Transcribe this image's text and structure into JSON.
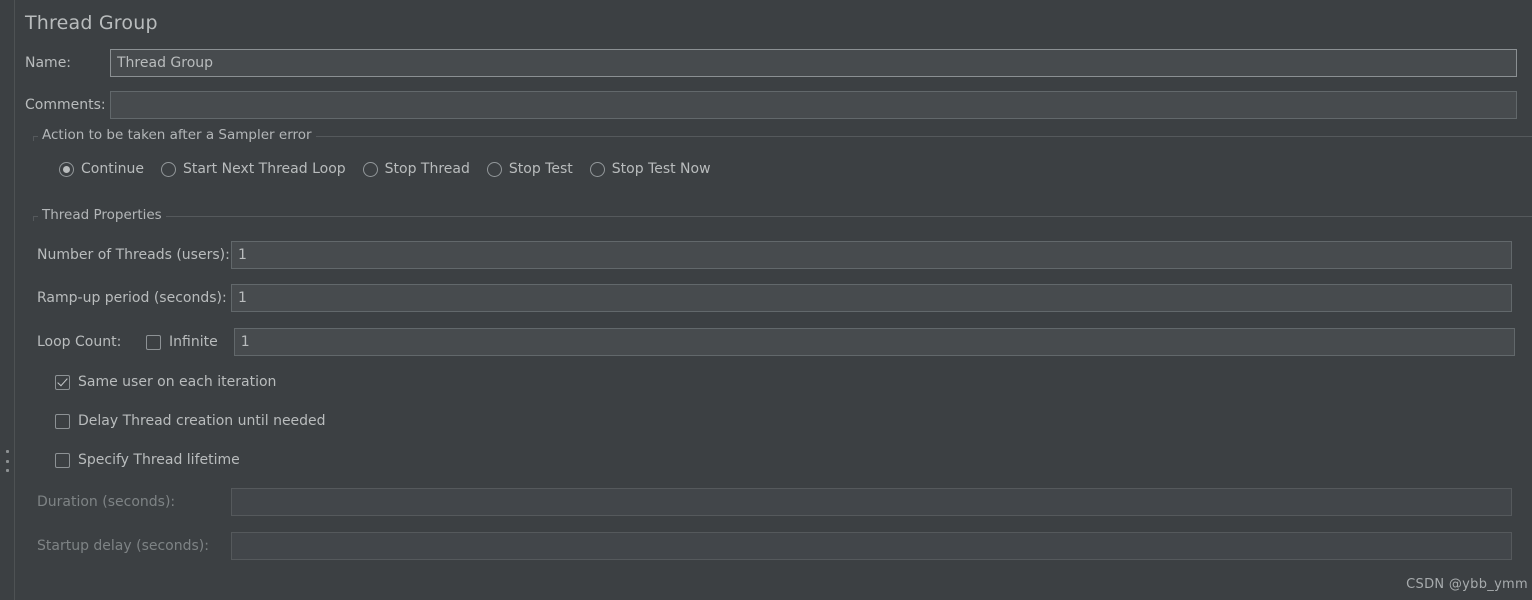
{
  "panel": {
    "title": "Thread Group"
  },
  "fields": {
    "name": {
      "label": "Name:",
      "value": "Thread Group",
      "placeholder": ""
    },
    "comments": {
      "label": "Comments:",
      "value": "",
      "placeholder": ""
    }
  },
  "sampler_error_group": {
    "title": "Action to be taken after a Sampler error",
    "selected": "Continue",
    "options": [
      {
        "label": "Continue",
        "checked": true
      },
      {
        "label": "Start Next Thread Loop",
        "checked": false
      },
      {
        "label": "Stop Thread",
        "checked": false
      },
      {
        "label": "Stop Test",
        "checked": false
      },
      {
        "label": "Stop Test Now",
        "checked": false
      }
    ]
  },
  "thread_properties": {
    "title": "Thread Properties",
    "number_of_threads": {
      "label": "Number of Threads (users):",
      "value": "1"
    },
    "ramp_up": {
      "label": "Ramp-up period (seconds):",
      "value": "1"
    },
    "loop_count": {
      "label": "Loop Count:",
      "infinite_label": "Infinite",
      "infinite_checked": false,
      "value": "1"
    },
    "checkboxes": [
      {
        "label": "Same user on each iteration",
        "checked": true
      },
      {
        "label": "Delay Thread creation until needed",
        "checked": false
      },
      {
        "label": "Specify Thread lifetime",
        "checked": false
      }
    ],
    "duration": {
      "label": "Duration (seconds):",
      "value": "",
      "disabled": true
    },
    "startup_delay": {
      "label": "Startup delay (seconds):",
      "value": "",
      "disabled": true
    }
  },
  "watermark": {
    "text": "CSDN @ybb_ymm"
  }
}
